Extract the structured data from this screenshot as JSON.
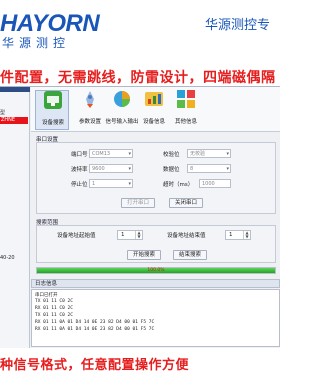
{
  "header": {
    "brand": "HAYORN",
    "brand_sub": "华源测控",
    "tagline": "华源测控专",
    "headline": "件配置，无需跳线，防雷设计，四端磁偶隔"
  },
  "left_panel": {
    "label_top": "型",
    "selected_item": "ZHNE",
    "bottom_value": "40-20"
  },
  "toolbar": {
    "tools": [
      {
        "label": "设备搜索",
        "icon": "device-search-icon",
        "color": "#3aa53a"
      },
      {
        "label": "参数设置",
        "icon": "rocket-icon",
        "color": "#4a7cc4"
      },
      {
        "label": "信号输入输出",
        "icon": "pie-chart-icon",
        "color": "#e8a020"
      },
      {
        "label": "设备信息",
        "icon": "chart-icon",
        "color": "#d84020"
      },
      {
        "label": "其他信息",
        "icon": "grid-icon",
        "color": "#2aa0d8"
      }
    ]
  },
  "serial": {
    "title": "串口设置",
    "port_label": "端口号",
    "port_value": "COM13",
    "baud_label": "波特率",
    "baud_value": "9600",
    "stop_label": "停止位",
    "stop_value": "1",
    "parity_label": "校验位",
    "parity_value": "无校验",
    "data_label": "数据位",
    "data_value": "8",
    "timeout_label": "超时（ms）",
    "timeout_value": "1000",
    "open_button": "打开串口",
    "close_button": "关闭串口"
  },
  "search": {
    "title": "搜索范围",
    "start_label": "设备地址起始值",
    "start_value": "1",
    "end_label": "设备地址结束值",
    "end_value": "1",
    "start_button": "开始搜索",
    "stop_button": "结束搜索"
  },
  "progress": {
    "value": 1.0,
    "text": "100.0%"
  },
  "log": {
    "title": "日志信息",
    "lines": [
      "串口已打开",
      "TX 01 11 C0 2C",
      "RX 01 11 C0 2C",
      "TX 01 11 C0 2C",
      "RX 01 11 0A 01 D4 14 0E 23 82 D4 00 01 F5 7C",
      "RX 01 11 0A 01 D4 14 0E 23 82 D4 00 01 F5 7C"
    ]
  },
  "footer": {
    "text": "种信号格式，任意配置操作方便"
  }
}
